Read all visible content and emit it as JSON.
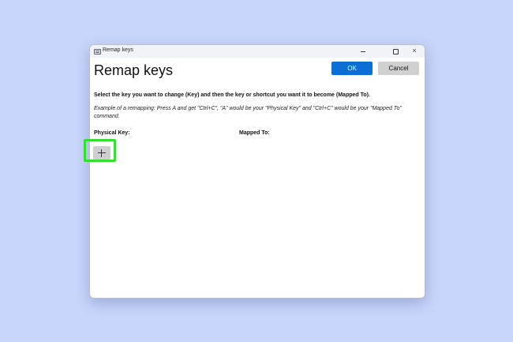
{
  "window": {
    "title": "Remap keys",
    "caption_buttons": {
      "minimize": "minimize-icon",
      "maximize": "maximize-icon",
      "close": "×"
    }
  },
  "header": {
    "heading": "Remap keys",
    "ok_label": "OK",
    "cancel_label": "Cancel"
  },
  "content": {
    "instruction": "Select the key you want to change (Key) and then the key or shortcut you want it to become (Mapped To).",
    "example": "Example of a remapping: Press A and get \"Ctrl+C\", \"A\" would be your \"Physical Key\" and \"Ctrl+C\" would be your \"Mapped To\" command.",
    "physical_key_header": "Physical Key:",
    "mapped_to_header": "Mapped To:",
    "add_button_icon": "plus-icon"
  },
  "colors": {
    "background": "#c9d6fb",
    "accent": "#0b6fd6",
    "highlight": "#33e02f"
  }
}
